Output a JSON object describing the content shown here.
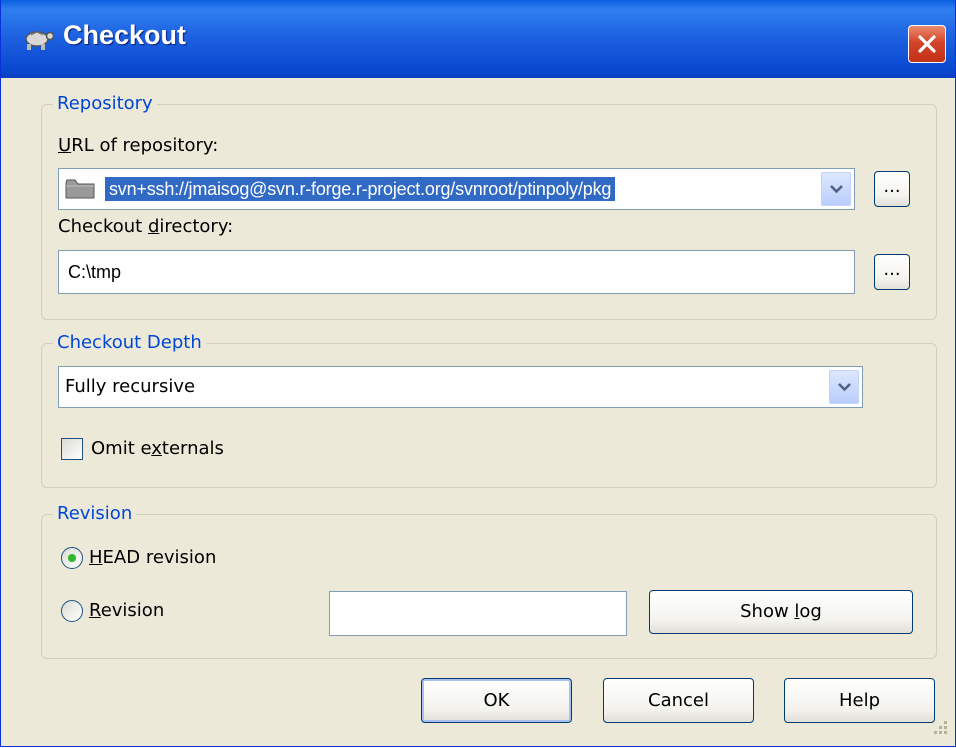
{
  "window": {
    "title": "Checkout"
  },
  "repository": {
    "group_label": "Repository",
    "url_label_accel": "U",
    "url_label_rest": "RL of repository:",
    "url_value": "svn+ssh://jmaisog@svn.r-forge.r-project.org/svnroot/ptinpoly/pkg",
    "browse_url_label": "...",
    "dir_label_pre": "Checkout ",
    "dir_label_accel": "d",
    "dir_label_post": "irectory:",
    "dir_value": "C:\\tmp",
    "browse_dir_label": "..."
  },
  "depth": {
    "group_label": "Checkout Depth",
    "selected": "Fully recursive",
    "omit_pre": "Omit e",
    "omit_accel": "x",
    "omit_post": "ternals",
    "omit_checked": false
  },
  "revision": {
    "group_label": "Revision",
    "head_accel": "H",
    "head_rest": "EAD revision",
    "head_selected": true,
    "rev_accel": "R",
    "rev_rest": "evision",
    "rev_value": "",
    "show_log_pre": "Show ",
    "show_log_accel": "l",
    "show_log_post": "og"
  },
  "buttons": {
    "ok": "OK",
    "cancel": "Cancel",
    "help": "Help"
  },
  "colors": {
    "title_bar": "#0a5fe0",
    "group_label": "#0046d5",
    "selection": "#316ac5",
    "close": "#d4442a"
  }
}
